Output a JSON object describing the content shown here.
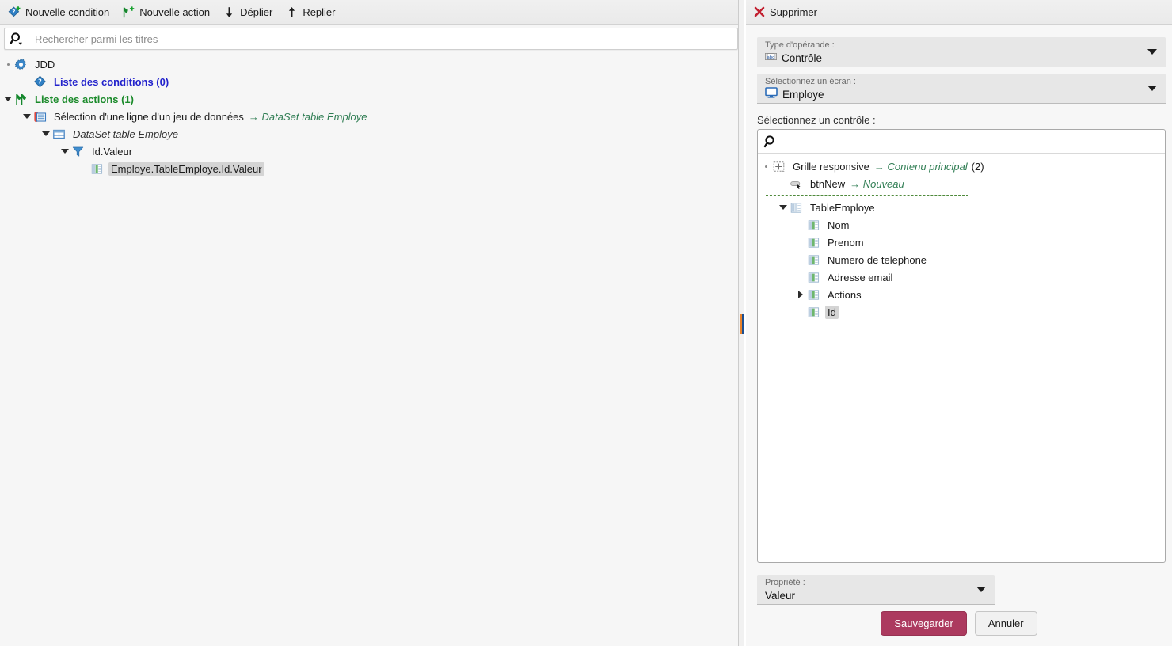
{
  "left": {
    "toolbar": [
      {
        "label": "Nouvelle condition",
        "icon": "condition-add-icon"
      },
      {
        "label": "Nouvelle action",
        "icon": "action-add-icon"
      },
      {
        "label": "Déplier",
        "icon": "expand-down-icon"
      },
      {
        "label": "Replier",
        "icon": "collapse-up-icon"
      }
    ],
    "search": {
      "placeholder": "Rechercher parmi les titres",
      "value": "",
      "icon": "search-icon"
    },
    "tree": [
      {
        "label": "JDD",
        "icon": "gear-icon",
        "indent": 0,
        "twisty": "dot",
        "style": "plain"
      },
      {
        "label": "Liste des conditions (0)",
        "icon": "condition-icon",
        "indent": 1,
        "twisty": "none",
        "style": "blue"
      },
      {
        "label": "Liste des actions (1)",
        "icon": "actions-icon",
        "indent": 0,
        "twisty": "down",
        "style": "green"
      },
      {
        "label": "Sélection d'une ligne d'un jeu de données",
        "suffix": "DataSet table Employe",
        "icon": "dataset-row-icon",
        "indent": 1,
        "twisty": "down",
        "style": "plain"
      },
      {
        "label": "DataSet table Employe",
        "icon": "grid-icon",
        "indent": 2,
        "twisty": "down",
        "style": "italic"
      },
      {
        "label": "Id.Valeur",
        "icon": "filter-icon",
        "indent": 3,
        "twisty": "down",
        "style": "plain"
      },
      {
        "label": "Employe.TableEmploye.Id.Valeur",
        "icon": "column-icon",
        "indent": 4,
        "twisty": "none",
        "style": "selected"
      }
    ]
  },
  "right": {
    "header": {
      "label": "Supprimer",
      "icon": "delete-x-icon"
    },
    "operand": {
      "label": "Type d'opérande :",
      "value": "Contrôle",
      "icon": "textbox-abc-icon"
    },
    "screen": {
      "label": "Sélectionnez un écran :",
      "value": "Employe",
      "icon": "monitor-icon"
    },
    "control": {
      "label": "Sélectionnez un contrôle :",
      "search": {
        "placeholder": "",
        "value": "",
        "icon": "search-icon"
      },
      "tree": [
        {
          "label": "Grille responsive",
          "arrow": "Contenu principal",
          "count": "(2)",
          "icon": "responsive-grid-icon",
          "indent": 0,
          "twisty": "dot"
        },
        {
          "label": "btnNew",
          "arrow": "Nouveau",
          "icon": "button-icon",
          "indent": 1,
          "twisty": "none"
        },
        {
          "divider": true
        },
        {
          "label": "TableEmploye",
          "icon": "table-icon",
          "indent": 1,
          "twisty": "down"
        },
        {
          "label": "Nom",
          "icon": "column-icon",
          "indent": 2,
          "twisty": "none"
        },
        {
          "label": "Prenom",
          "icon": "column-icon",
          "indent": 2,
          "twisty": "none"
        },
        {
          "label": "Numero de telephone",
          "icon": "column-icon",
          "indent": 2,
          "twisty": "none"
        },
        {
          "label": "Adresse email",
          "icon": "column-icon",
          "indent": 2,
          "twisty": "none"
        },
        {
          "label": "Actions",
          "icon": "column-icon",
          "indent": 2,
          "twisty": "right"
        },
        {
          "label": "Id",
          "icon": "column-icon",
          "indent": 2,
          "twisty": "none",
          "selected": true
        }
      ]
    },
    "property": {
      "label": "Propriété :",
      "value": "Valeur"
    },
    "buttons": {
      "save": "Sauvegarder",
      "cancel": "Annuler"
    }
  },
  "colors": {
    "accent_primary": "#ac3a5f",
    "tree_blue": "#2222cc",
    "tree_green": "#1a8a2a",
    "arrow_green": "#2f7d53",
    "splitter_orange": "#e8822a",
    "splitter_blue": "#1c4f91",
    "delete_red": "#c22030"
  }
}
